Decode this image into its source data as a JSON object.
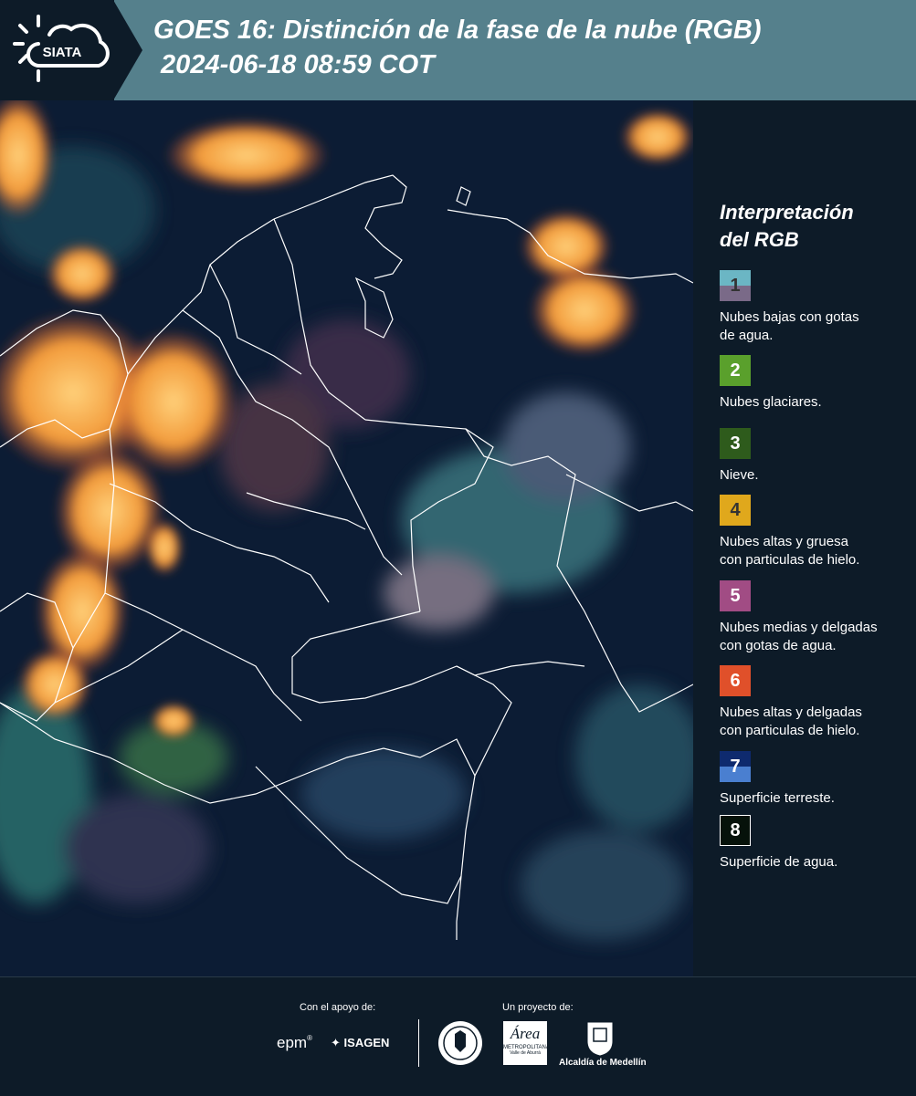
{
  "header": {
    "logo_text": "SIATA",
    "title_line1": "GOES 16: Distinción de la fase de la nube (RGB)",
    "title_line2": " 2024-06-18 08:59 COT"
  },
  "legend": {
    "title_line1": "Interpretación",
    "title_line2": "del RGB",
    "items": [
      {
        "number": "1",
        "label_line1": "Nubes bajas con gotas",
        "label_line2": "de agua.",
        "color_top": "#6bb6c4",
        "color_bottom": "#7a6a88",
        "text_color": "#333333"
      },
      {
        "number": "2",
        "label_line1": "Nubes glaciares.",
        "label_line2": "",
        "color_top": "#5aa02c",
        "color_bottom": "#5aa02c",
        "text_color": "#ffffff"
      },
      {
        "number": "3",
        "label_line1": "Nieve.",
        "label_line2": "",
        "color_top": "#2e5b1c",
        "color_bottom": "#2e5b1c",
        "text_color": "#ffffff"
      },
      {
        "number": "4",
        "label_line1": "Nubes altas y gruesa",
        "label_line2": "con particulas de hielo.",
        "color_top": "#e0a81c",
        "color_bottom": "#e0a81c",
        "text_color": "#333333"
      },
      {
        "number": "5",
        "label_line1": "Nubes medias y delgadas",
        "label_line2": "con gotas de agua.",
        "color_top": "#a14c84",
        "color_bottom": "#a14c84",
        "text_color": "#ffffff"
      },
      {
        "number": "6",
        "label_line1": "Nubes altas y delgadas",
        "label_line2": "con particulas de hielo.",
        "color_top": "#e0502a",
        "color_bottom": "#e0502a",
        "text_color": "#ffffff"
      },
      {
        "number": "7",
        "label_line1": "Superficie terreste.",
        "label_line2": "",
        "color_top": "#0e2a6e",
        "color_bottom": "#4a7fd0",
        "text_color": "#ffffff"
      },
      {
        "number": "8",
        "label_line1": "Superficie de agua.",
        "label_line2": "",
        "color_top": "#06120a",
        "color_bottom": "#06120a",
        "text_color": "#ffffff"
      }
    ]
  },
  "footer": {
    "support_label": "Con el apoyo de:",
    "project_label": "Un proyecto de:",
    "sponsor_epm": "epm",
    "sponsor_isagen": "ISAGEN",
    "area_line1": "Área",
    "area_line2": "METROPOLITANA",
    "area_line3": "Valle de Aburrá",
    "alcaldia": "Alcaldía de Medellín"
  }
}
